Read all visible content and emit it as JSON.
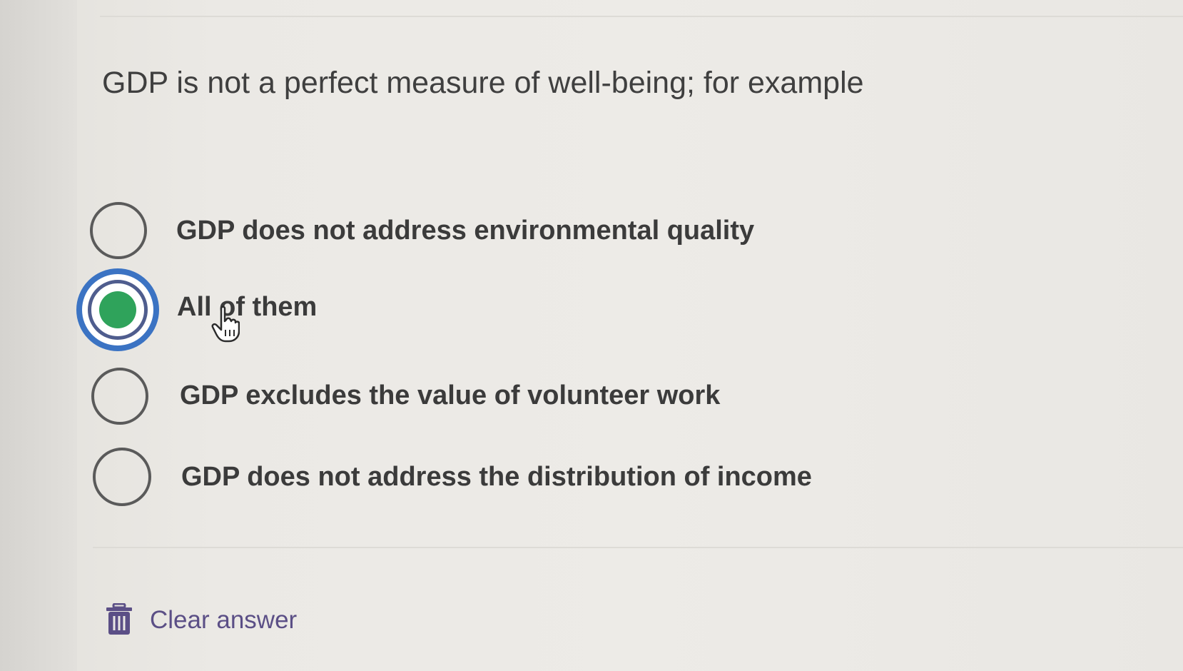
{
  "question": {
    "text": "GDP is not a perfect measure of well-being; for example"
  },
  "options": [
    {
      "label": "GDP does not address environmental quality",
      "selected": false
    },
    {
      "label": "All of them",
      "selected": true
    },
    {
      "label": "GDP excludes the value of volunteer work",
      "selected": false
    },
    {
      "label": "GDP does not address the distribution of income",
      "selected": false
    }
  ],
  "clear": {
    "label": "Clear answer",
    "icon": "trash-icon"
  },
  "colors": {
    "selected_ring": "#3b73c3",
    "selected_dot": "#2fa35b",
    "clear_text": "#5b4f86"
  }
}
